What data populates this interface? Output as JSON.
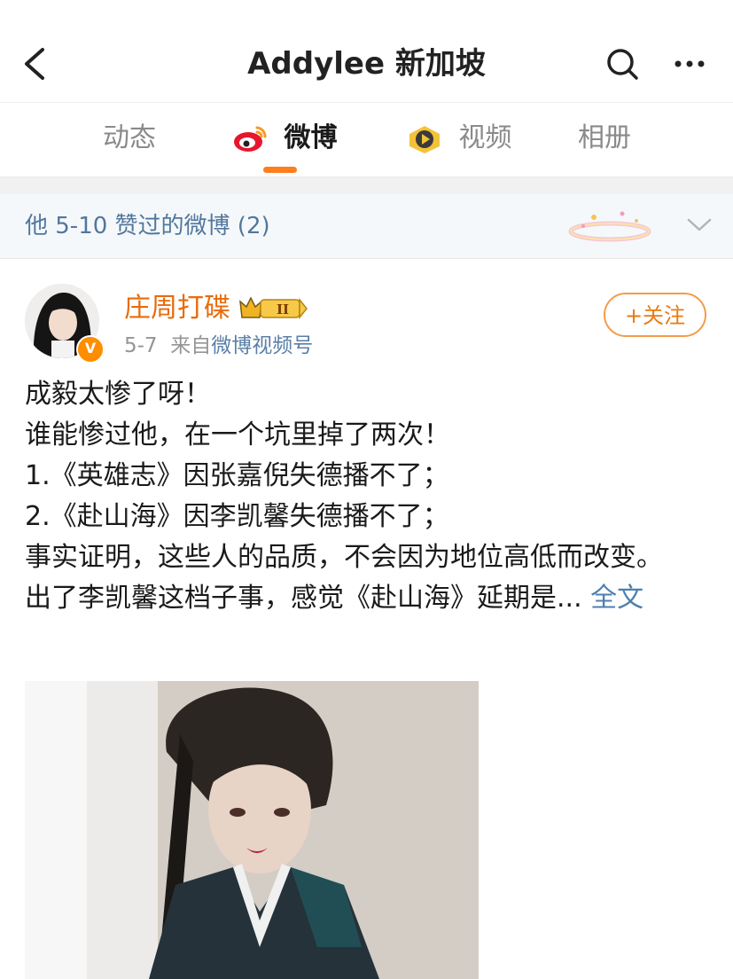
{
  "header": {
    "title": "Addylee 新加坡",
    "back_icon": "chevron-left-icon",
    "search_icon": "search-icon",
    "more_icon": "more-dots-icon"
  },
  "tabs": [
    {
      "label": "动态",
      "active": false
    },
    {
      "label": "微博",
      "active": true,
      "icon": "weibo-logo-icon"
    },
    {
      "label": "视频",
      "active": false,
      "icon": "video-play-icon"
    },
    {
      "label": "相册",
      "active": false
    }
  ],
  "liked_bar": {
    "label": "他 5-10 赞过的微博 (2)",
    "icon": "chevron-down-icon"
  },
  "post": {
    "username": "庄周打碟",
    "rank_badge": "II",
    "verified_badge": "V",
    "date": "5-7",
    "source_prefix": "来自",
    "source": "微博视频号",
    "follow_label": "+关注",
    "lines": [
      "成毅太惨了呀！",
      "谁能惨过他，在一个坑里掉了两次！",
      "1.《英雄志》因张嘉倪失德播不了；",
      "2.《赴山海》因李凯馨失德播不了；",
      "事实证明，这些人的品质，不会因为地位高低而改变。"
    ],
    "last_line": "出了李凯馨这档子事，感觉《赴山海》延期是...",
    "expand_label": "全文"
  },
  "colors": {
    "accent": "#ff7e1d",
    "username": "#e86b0c",
    "link": "#4f7fb0",
    "liked_bar_bg": "#f5f8fb"
  }
}
